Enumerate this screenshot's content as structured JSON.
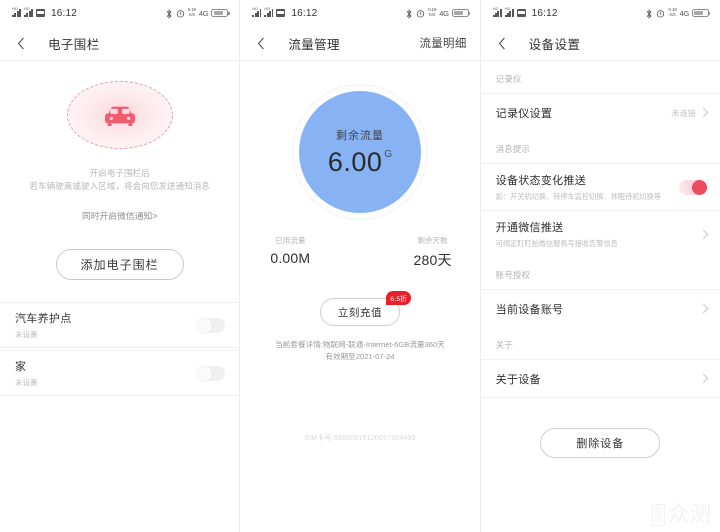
{
  "status_bar": {
    "time": "16:12",
    "sim_labels": [
      "HD",
      "HD"
    ],
    "net_speed_top": "0.19",
    "net_speed_bottom": "K/s",
    "network": "4G",
    "icons": [
      "signal-icon",
      "signal-icon",
      "sd-card-icon",
      "bluetooth-icon",
      "alarm-icon",
      "network-speed-icon",
      "lte-icon",
      "battery-icon"
    ]
  },
  "panel_fence": {
    "nav": {
      "title": "电子围栏",
      "back": "back-icon"
    },
    "hero": {
      "icon": "car-icon",
      "desc_line1": "开启电子围栏后",
      "desc_line2": "若车辆驶离或驶入区域，将会向您发送通知消息",
      "link": "同时开启微信通知>"
    },
    "add_button": "添加电子围栏",
    "list": [
      {
        "title": "汽车养护点",
        "sub": "未设置",
        "toggle_on": false
      },
      {
        "title": "家",
        "sub": "未设置",
        "toggle_on": false
      }
    ]
  },
  "panel_data": {
    "nav": {
      "title": "流量管理",
      "action": "流量明细",
      "back": "back-icon"
    },
    "gauge": {
      "label": "剩余流量",
      "value": "6.00",
      "unit": "G",
      "color": "#87b3f5"
    },
    "stats": [
      {
        "label": "已用流量",
        "value": "0.00M"
      },
      {
        "label": "剩余天数",
        "value": "280天"
      }
    ],
    "recharge": {
      "label": "立刻充值",
      "badge": "6.5折",
      "badge_color": "#e8202b"
    },
    "plan_line1": "当前套餐详情:物联网-联通-Internet-6GB流量360天",
    "plan_line2": "有效期至2021-07-24",
    "sim": "SIM卡号:89860619120057364499"
  },
  "panel_settings": {
    "nav": {
      "title": "设备设置",
      "back": "back-icon"
    },
    "sections": [
      {
        "header": "记录仪",
        "rows": [
          {
            "title": "记录仪设置",
            "sub": "",
            "value": "未连接",
            "chevron": true,
            "toggle": null
          }
        ]
      },
      {
        "header": "消息提示",
        "rows": [
          {
            "title": "设备状态变化推送",
            "sub": "如：开关机切换、转停车监控切换、休眠待机切换等",
            "value": "",
            "chevron": false,
            "toggle": true
          },
          {
            "title": "开通微信推送",
            "sub": "可绑定盯盯拍微信服务号接收告警信息",
            "value": "",
            "chevron": true,
            "toggle": null
          }
        ]
      },
      {
        "header": "账号授权",
        "rows": [
          {
            "title": "当前设备账号",
            "sub": "",
            "value": "",
            "chevron": true,
            "toggle": null
          }
        ]
      },
      {
        "header": "关于",
        "rows": [
          {
            "title": "关于设备",
            "sub": "",
            "value": "",
            "chevron": true,
            "toggle": null
          }
        ]
      }
    ],
    "delete_button": "删除设备"
  },
  "watermark": {
    "brand_small_top": "新",
    "brand_small_bottom": "浪",
    "brand_big": "众测"
  }
}
